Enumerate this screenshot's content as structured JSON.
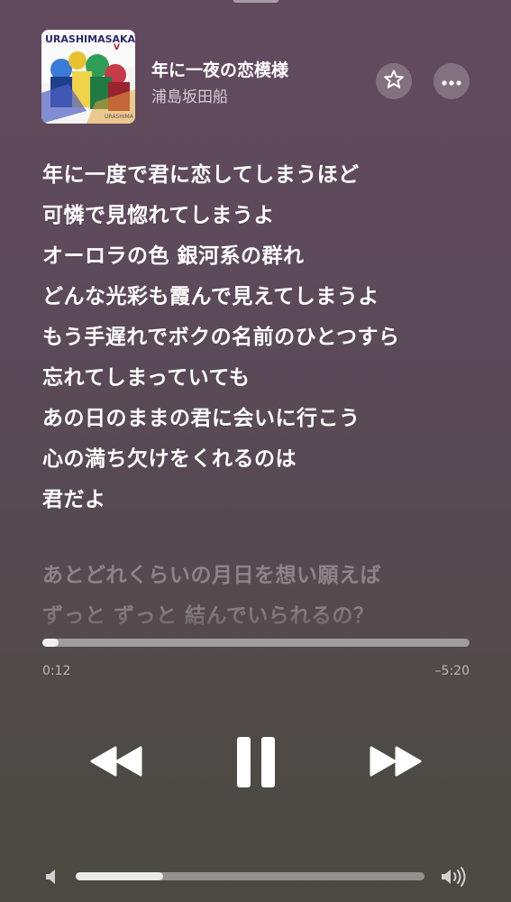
{
  "header": {
    "title": "年に一夜の恋模様",
    "artist": "浦島坂田船",
    "art_text": "URASHIMASAKATASEN"
  },
  "lyrics": {
    "current": [
      "年に一度で君に恋してしまうほど",
      "可憐で見惚れてしまうよ",
      "オーロラの色 銀河系の群れ",
      "どんな光彩も霞んで見えてしまうよ",
      "もう手遅れでボクの名前のひとつすら",
      "忘れてしまっていても",
      "あの日のままの君に会いに行こう",
      "心の満ち欠けをくれるのは",
      "君だよ"
    ],
    "upcoming": [
      "あとどれくらいの月日を想い願えば",
      "ずっと ずっと 結んでいられるの？"
    ]
  },
  "playback": {
    "elapsed": "0:12",
    "remaining": "–5:20",
    "progress_fraction": 0.037
  },
  "volume": {
    "level_fraction": 0.25
  },
  "icons": {
    "star": "star-outline-icon",
    "more": "ellipsis-icon",
    "previous": "backward-icon",
    "pause": "pause-icon",
    "next": "forward-icon",
    "volume_low": "speaker-icon",
    "volume_high": "speaker-waves-icon"
  }
}
